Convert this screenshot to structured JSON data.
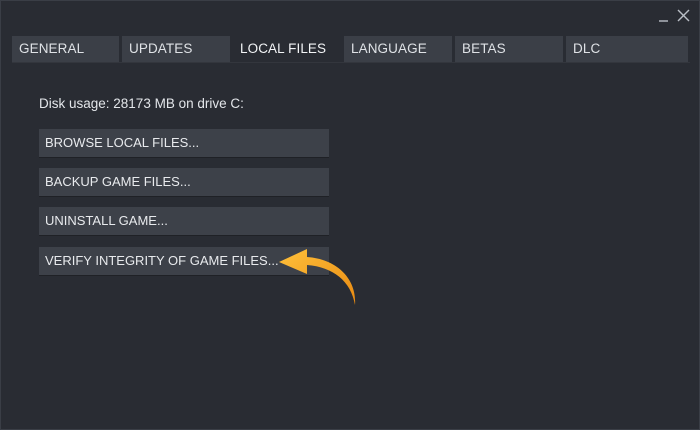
{
  "window": {
    "minimize_icon": "minimize-icon",
    "close_icon": "close-icon"
  },
  "tabs": [
    {
      "label": "GENERAL",
      "active": false
    },
    {
      "label": "UPDATES",
      "active": false
    },
    {
      "label": "LOCAL FILES",
      "active": true
    },
    {
      "label": "LANGUAGE",
      "active": false
    },
    {
      "label": "BETAS",
      "active": false
    },
    {
      "label": "DLC",
      "active": false
    }
  ],
  "local_files": {
    "disk_usage": "Disk usage: 28173 MB on drive C:",
    "buttons": {
      "browse": "BROWSE LOCAL FILES...",
      "backup": "BACKUP GAME FILES...",
      "uninstall": "UNINSTALL GAME...",
      "verify": "VERIFY INTEGRITY OF GAME FILES..."
    }
  },
  "annotation": {
    "icon": "curved-arrow-icon",
    "color": "#f5a623"
  }
}
